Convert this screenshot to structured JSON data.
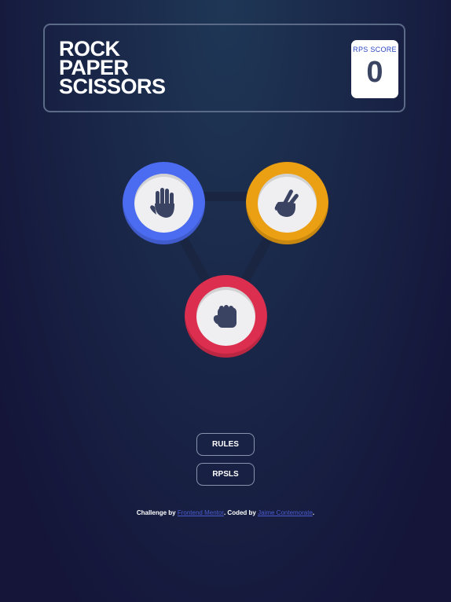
{
  "header": {
    "title_lines": [
      "ROCK",
      "PAPER",
      "SCISSORS"
    ],
    "score_label": "RPS SCORE",
    "score_value": "0"
  },
  "tokens": [
    {
      "id": "paper",
      "icon": "paper-hand-icon",
      "color": "#4b6cf0"
    },
    {
      "id": "scissors",
      "icon": "scissors-hand-icon",
      "color": "#eb9f12"
    },
    {
      "id": "rock",
      "icon": "rock-fist-icon",
      "color": "#dc2e4e"
    }
  ],
  "buttons": {
    "rules_label": "RULES",
    "rpsls_label": "RPSLS"
  },
  "footer": {
    "prefix": "Challenge by ",
    "link1": "Frontend Mentor",
    "middle": ". Coded by ",
    "link2": "Jaime Contemorate",
    "suffix": "."
  },
  "colors": {
    "background": "#141539",
    "header_border": "#5b6a86",
    "score_text": "#3b4363",
    "link": "#4b5cd0"
  }
}
